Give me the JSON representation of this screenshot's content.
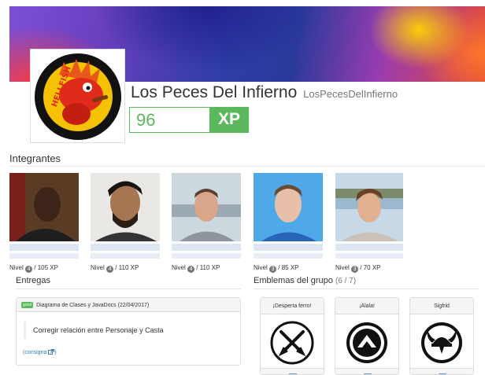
{
  "group": {
    "name": "Los Peces Del Infierno",
    "handle": "LosPecesDelInfierno",
    "xp_value": "96",
    "xp_label": "XP",
    "logo_text": "HELLFISH"
  },
  "members_section": {
    "title": "Integrantes"
  },
  "members": [
    {
      "level": "4",
      "xp": "/ 105 XP",
      "level_prefix": "Nivel"
    },
    {
      "level": "4",
      "xp": "/ 110 XP",
      "level_prefix": "Nivel"
    },
    {
      "level": "4",
      "xp": "/ 110 XP",
      "level_prefix": "Nivel"
    },
    {
      "level": "3",
      "xp": "/ 85 XP",
      "level_prefix": "Nivel"
    },
    {
      "level": "3",
      "xp": "/ 70 XP",
      "level_prefix": "Nivel"
    }
  ],
  "entregas": {
    "title": "Entregas",
    "item": {
      "badge": "good",
      "title": "Diagrama de Clases y JavaDocs (22/04/2017)",
      "comment": "Corregir relación entre Personaje y Casta",
      "link": "(consigna"
    }
  },
  "emblemas": {
    "title": "Emblemas del grupo",
    "count": "(6 / 7)",
    "items": [
      {
        "name": "¡Desperta ferro!",
        "icon": "crossed-swords-icon"
      },
      {
        "name": "¡Alala!",
        "icon": "spartan-shield-icon"
      },
      {
        "name": "Sigfrid",
        "icon": "viking-helmet-icon"
      }
    ]
  },
  "colors": {
    "xp_green": "#5cb85c",
    "link_blue": "#337ab7",
    "badge_gray": "#777777"
  }
}
